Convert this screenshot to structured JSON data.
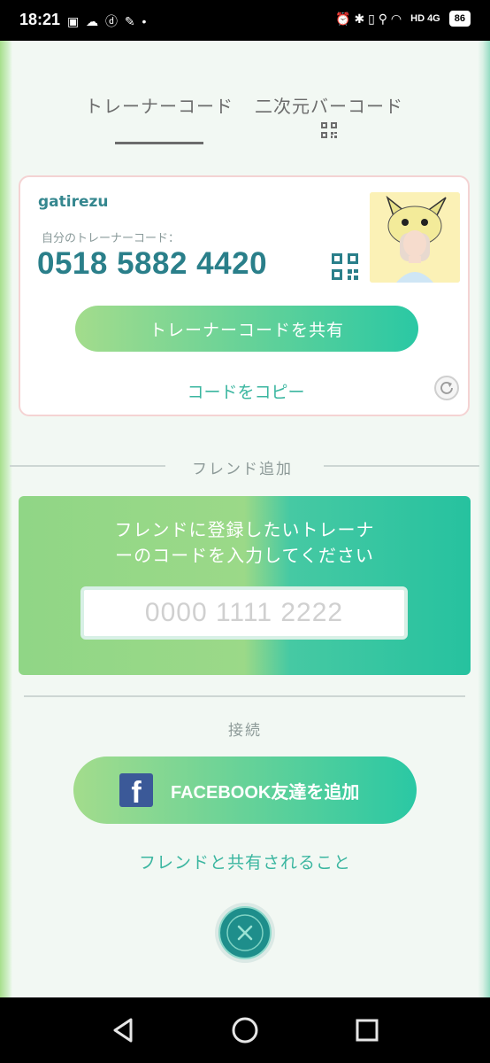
{
  "status_bar": {
    "time": "18:21",
    "left_icons": "▣ ☁ ⓓ ✎ •",
    "right_icons": "⏰ ✱ ▯ ⚲ ◠",
    "network": "HD 4G",
    "battery": "86"
  },
  "tabs": {
    "trainer_code": "トレーナーコード",
    "barcode": "二次元バーコード"
  },
  "profile": {
    "username": "gatirezu",
    "code_label": "自分のトレーナーコード：",
    "code_value": "0518 5882 4420",
    "share_button": "トレーナーコードを共有",
    "copy_link": "コードをコピー"
  },
  "add_friend": {
    "heading": "フレンド追加",
    "instruction_line1": "フレンドに登録したいトレーナ",
    "instruction_line2": "ーのコードを入力してください",
    "placeholder": "0000 1111 2222"
  },
  "connect": {
    "heading": "接続",
    "facebook_button": "FACEBOOK友達を追加",
    "shared_link": "フレンドと共有されること"
  },
  "colors": {
    "accent_teal": "#2ac8a4",
    "accent_green": "#a3dc8c",
    "code_text": "#2a7f8a",
    "facebook_blue": "#3b5998"
  }
}
